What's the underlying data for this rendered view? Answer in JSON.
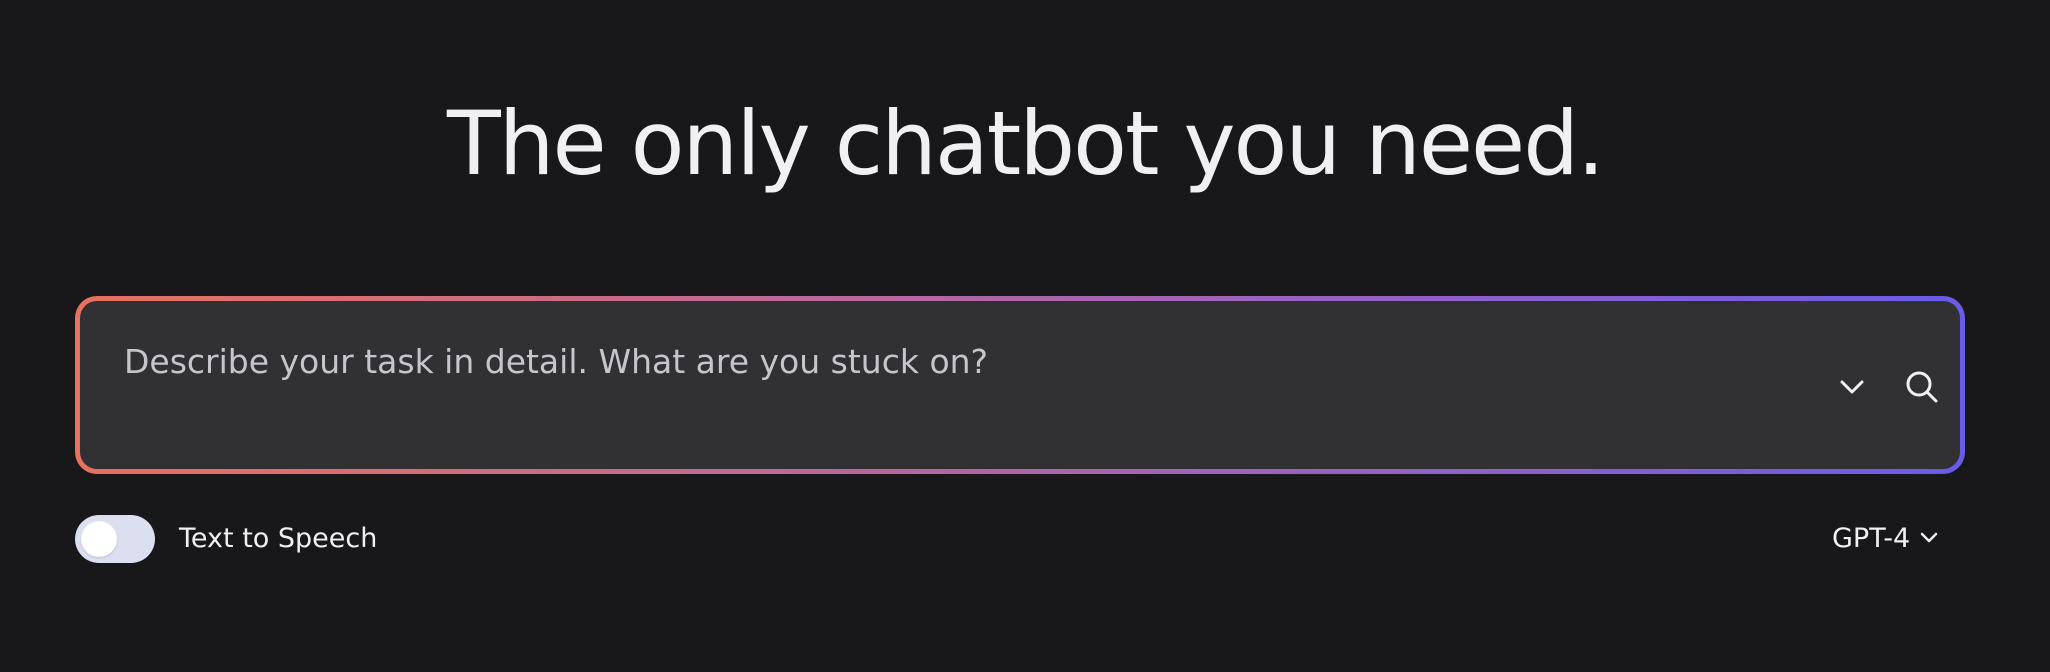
{
  "hero": {
    "title": "The only chatbot you need."
  },
  "prompt": {
    "placeholder": "Describe your task in detail. What are you stuck on?",
    "value": "",
    "chevron_icon": "chevron-down-icon",
    "search_icon": "search-icon",
    "gradient_colors": [
      "#e8715f",
      "#c16a93",
      "#9a62c0",
      "#6a5ce6"
    ]
  },
  "options": {
    "tts_label": "Text to Speech",
    "tts_enabled": false,
    "model_label": "GPT-4",
    "model_icon": "chevron-down-icon"
  }
}
